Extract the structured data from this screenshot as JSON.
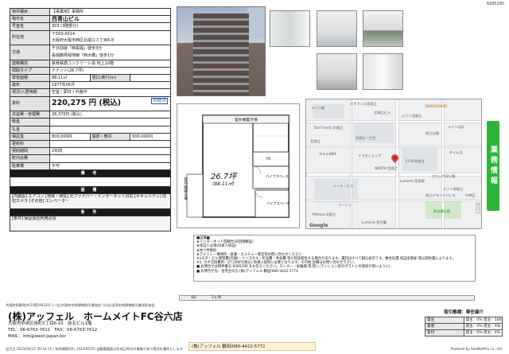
{
  "doc_id": "8285290",
  "table": {
    "rows": [
      {
        "k": "物件種目",
        "v": "【事業用】事務所"
      },
      {
        "k": "物件名",
        "v": "西青山ビル"
      },
      {
        "k": "号室名",
        "v": "303 (3階部分)"
      },
      {
        "k": "所在地",
        "v1": "〒550-0014",
        "v2": "大阪府大阪市西区北堀江３丁目6-8"
      },
      {
        "k": "交通",
        "v1": "千日前線「西長堀」徒歩3分",
        "v2": "長堀鶴見緑地線「西大橋」徒歩1分"
      },
      {
        "k": "建物構造",
        "v": "鉄骨鉄筋コンクリート造 地上10階"
      },
      {
        "k": "間取タイプ",
        "v": "テナント(26.7坪)"
      },
      {
        "k": "専有面積",
        "v": "88.11㎡",
        "k2": "間口/奥行(m)",
        "v2": ""
      },
      {
        "k": "築年",
        "v": "1977年06月"
      },
      {
        "k": "現況/入居時期",
        "v": "空室 / 即日 / 内装中"
      },
      {
        "k": "賃料",
        "v": "220,275 円 (税込)",
        "badge": "内税中"
      },
      {
        "k": "共益費・管理費",
        "v": "26,370円 (税込)"
      },
      {
        "k": "敷金",
        "v": ""
      },
      {
        "k": "礼金",
        "v": ""
      },
      {
        "k": "保証金",
        "v": "800,000円",
        "k2": "償却・敷引",
        "v2": "600,000円"
      },
      {
        "k": "更新料",
        "v": ""
      },
      {
        "k": "契約期間",
        "v": "2年間"
      },
      {
        "k": "町内会費",
        "v": ""
      },
      {
        "k": "駐車場",
        "v": "不可"
      }
    ],
    "bikou_label": "備 考",
    "setsubi_label": "設 備",
    "setsubi_text": "[内装設] エアコン [地域・通信] 光ファイバー・インターネット対応 [セキュリティ] 防犯カメラ [その他] エレベーター",
    "jouken_label": "条 件",
    "jouken_text": "[条件] 保証会社利用必須"
  },
  "floorplan": {
    "tsubo": "26.7坪",
    "area": "(88.11㎡)",
    "label_top": "室外機置き場",
    "label_side": "室外機置き場",
    "label_ps": "PS",
    "label_pipe1": "パイプスペース",
    "label_pipe2": "パイプスペース"
  },
  "map": {
    "labels": [
      "メゾン緑",
      "ネオフィス北堀江",
      "北堀江ビル",
      "WAREHOUSE",
      "メゾン北堀江",
      "Owl Forest 北堀江",
      "北堀江一丁目",
      "北堀江",
      "堀江公園",
      "メゾン北浜",
      "3-FVE北堀江",
      "ホテルWBF",
      "ドコモショップ",
      "タイムズ",
      "Lumiere 西長堀",
      "アクシア四ツ橋",
      "メゾン南堀江",
      "NORTH 北堀江",
      "Melona 北堀江",
      "堀江グランドパレス",
      "中央区",
      "高台橋公園",
      "トール・ビル",
      "イートン",
      "Lumiere 西大橋"
    ],
    "brand": "Google"
  },
  "notes": [
    "■設備■",
    "★インターネット回線付(光回線敷設)",
    "★保証人必須(日本人保証)",
    "★仲介手数料",
    "★アドリン・事務所・倉庫・カルチャー教室等お問い合わせください",
    "※eモヂ・ビル管理費(月額)・クリスタル・町会費・共益費 等が別途発生する場合があります。賃料はすべて税込表示です。敷金返還 保証金償却 等は契約書によります。",
    "※1. カギ交換費用：27,500円(税込) 新規入居時に必要となります。その他 詳細はお問い合わせ下さい。",
    "■ お問合せは物件番号 8285290 をお伝えください。ロッカー・駐輪場 等 無し(マンション前のポストとの混同が無いように)",
    "■ お問合せ先：住宅主の方 (株)アッフェル 鶴田/080-4422-5772"
  ],
  "strip": {
    "a": "4D",
    "b": "2ヶ月"
  },
  "disclaimer": "大阪府知事免許(2)第59432号 (一社)大阪府宅地建物取引業協会 (公社)全国宅地建物取引業保証協会",
  "company": {
    "name": "(株)アッフェル　ホームメイトFC谷六店",
    "address": "大阪市中央区谷町5丁目6-10　谷五ビル1階",
    "tel": "TEL：06-6763-7611　FAX：06-6763-7612",
    "mail": "MAIL：info@west-japan.biz"
  },
  "fee": {
    "title": "取引態様：専任媒介",
    "rows": [
      {
        "k": "貸主",
        "v": "貸主：0% 借主：100%"
      },
      {
        "k": "業者",
        "v": "貸主：0% 借主：0%"
      },
      {
        "k": "客付",
        "v": "貸主：0% 借主：0%"
      }
    ]
  },
  "contact": "(株)アッフェル 鶴田/080-4422-5772",
  "side_tab": "業務情報",
  "footer": {
    "left": "出力日 2023/04/15 09:33:15 / 有効期限切れ 2023/05/15 当概要図面は作成日時点の情報であり現況を優先とします",
    "right": "Powered by RealNetPro co., ltd."
  }
}
